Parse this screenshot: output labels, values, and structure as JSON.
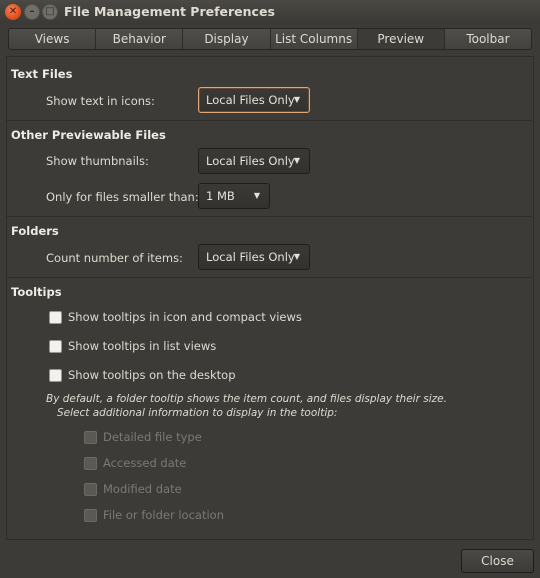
{
  "window": {
    "title": "File Management Preferences"
  },
  "tabs": [
    "Views",
    "Behavior",
    "Display",
    "List Columns",
    "Preview",
    "Toolbar"
  ],
  "active_tab": "Preview",
  "text_files": {
    "heading": "Text Files",
    "show_text_label": "Show text in icons:",
    "show_text_value": "Local Files Only"
  },
  "other_previewable": {
    "heading": "Other Previewable Files",
    "thumbnails_label": "Show thumbnails:",
    "thumbnails_value": "Local Files Only",
    "size_limit_label": "Only for files smaller than:",
    "size_limit_value": "1 MB"
  },
  "folders": {
    "heading": "Folders",
    "count_label": "Count number of items:",
    "count_value": "Local Files Only"
  },
  "tooltips": {
    "heading": "Tooltips",
    "options": [
      {
        "label": "Show tooltips in icon and compact views",
        "checked": false
      },
      {
        "label": "Show tooltips in list views",
        "checked": false
      },
      {
        "label": "Show tooltips on the desktop",
        "checked": false
      }
    ],
    "info_line1": "By default, a folder tooltip shows the item count, and files display their size.",
    "info_line2": "Select additional information to display in the tooltip:",
    "extra_options": [
      {
        "label": "Detailed file type",
        "checked": false,
        "enabled": false
      },
      {
        "label": "Accessed date",
        "checked": false,
        "enabled": false
      },
      {
        "label": "Modified date",
        "checked": false,
        "enabled": false
      },
      {
        "label": "File or folder location",
        "checked": false,
        "enabled": false
      }
    ]
  },
  "footer": {
    "close_label": "Close"
  },
  "colors": {
    "window_bg": "#3c3b37",
    "focus_ring": "#e0a678",
    "close_button": "#e4501f"
  }
}
